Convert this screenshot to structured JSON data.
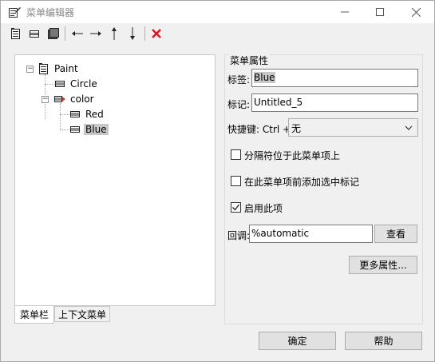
{
  "window": {
    "title": "菜单编辑器",
    "minimize_glyph": "—",
    "maximize_glyph": "☐",
    "close_glyph": "✕"
  },
  "toolbar": {
    "buttons": [
      {
        "name": "insert-item-icon"
      },
      {
        "name": "insert-separator-icon"
      },
      {
        "name": "insert-submenu-icon"
      },
      {
        "name": "outdent-arrow-icon"
      },
      {
        "name": "indent-arrow-icon"
      },
      {
        "name": "move-up-arrow-icon"
      },
      {
        "name": "move-down-arrow-icon"
      },
      {
        "name": "delete-icon"
      }
    ]
  },
  "tree": {
    "root": "Paint",
    "nodes": [
      {
        "label": "Paint"
      },
      {
        "label": "Circle"
      },
      {
        "label": "color"
      },
      {
        "label": "Red"
      },
      {
        "label": "Blue"
      }
    ],
    "selected": "Blue"
  },
  "tabs": {
    "menubar": "菜单栏",
    "context_menu": "上下文菜单"
  },
  "properties": {
    "group_title": "菜单属性",
    "label_caption": "标签:",
    "label_value": "Blue",
    "tag_caption": "标记:",
    "tag_value": "Untitled_5",
    "shortcut_caption": "快捷键: Ctrl +",
    "shortcut_value": "无",
    "separator_above": "分隔符位于此菜单项上",
    "separator_above_checked": false,
    "add_check_mark": "在此菜单项前添加选中标记",
    "add_check_mark_checked": false,
    "enable_item": "启用此项",
    "enable_item_checked": true,
    "callback_caption": "回调:",
    "callback_value": "%automatic",
    "view_button": "查看",
    "more_props_button": "更多属性..."
  },
  "footer": {
    "ok_button": "确定",
    "help_button": "帮助"
  },
  "colors": {
    "delete_red": "#e81123",
    "arrow_red": "#d03a2e",
    "selection_gray": "#c8c8c8"
  }
}
